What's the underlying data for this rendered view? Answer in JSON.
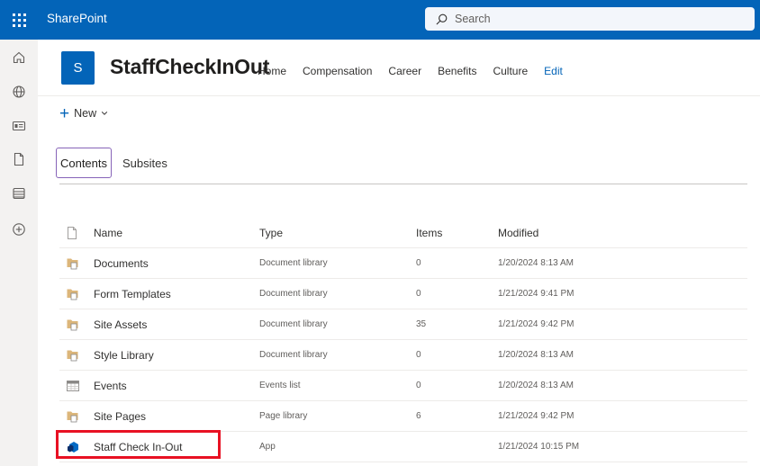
{
  "topbar": {
    "app_name": "SharePoint",
    "search_placeholder": "Search",
    "waffle_icon": "app-launcher-icon",
    "search_icon": "search-icon"
  },
  "rail": {
    "icons": [
      "home-icon",
      "globe-icon",
      "news-icon",
      "file-icon",
      "list-icon",
      "add-circle-icon"
    ]
  },
  "site": {
    "logo_letter": "S",
    "title": "StaffCheckInOut",
    "nav": [
      "Home",
      "Compensation",
      "Career",
      "Benefits",
      "Culture"
    ],
    "edit_label": "Edit"
  },
  "command": {
    "new_label": "New"
  },
  "tabs": {
    "contents": "Contents",
    "subsites": "Subsites"
  },
  "table": {
    "headers": {
      "name": "Name",
      "type": "Type",
      "items": "Items",
      "modified": "Modified"
    },
    "rows": [
      {
        "name": "Documents",
        "type": "Document library",
        "items": "0",
        "modified": "1/20/2024 8:13 AM",
        "icon": "library-icon"
      },
      {
        "name": "Form Templates",
        "type": "Document library",
        "items": "0",
        "modified": "1/21/2024 9:41 PM",
        "icon": "library-icon"
      },
      {
        "name": "Site Assets",
        "type": "Document library",
        "items": "35",
        "modified": "1/21/2024 9:42 PM",
        "icon": "library-icon"
      },
      {
        "name": "Style Library",
        "type": "Document library",
        "items": "0",
        "modified": "1/20/2024 8:13 AM",
        "icon": "library-icon"
      },
      {
        "name": "Events",
        "type": "Events list",
        "items": "0",
        "modified": "1/20/2024 8:13 AM",
        "icon": "calendar-list-icon"
      },
      {
        "name": "Site Pages",
        "type": "Page library",
        "items": "6",
        "modified": "1/21/2024 9:42 PM",
        "icon": "library-icon"
      },
      {
        "name": "Staff Check In-Out",
        "type": "App",
        "items": "",
        "modified": "1/21/2024 10:15 PM",
        "icon": "app-icon"
      }
    ]
  },
  "colors": {
    "suite_bar": "#0364b8",
    "accent": "#0364b8",
    "tab_border": "#8764b8",
    "highlight": "#e81123"
  }
}
